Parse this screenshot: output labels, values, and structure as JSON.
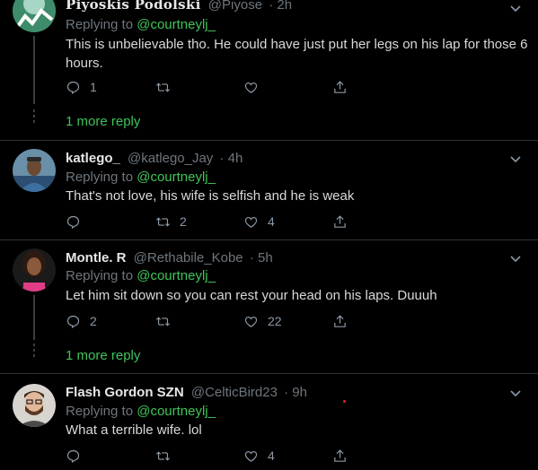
{
  "replies": [
    {
      "name": "Piyoskis Podolski",
      "handle": "@Piyose",
      "time": "· 2h",
      "replying_label": "Replying to",
      "replying_to": "@courtneylj_",
      "text": "This is unbelievable tho. He could have just put her legs on his lap for those 6 hours.",
      "reply_count": "1",
      "retweet_count": "",
      "like_count": "",
      "more_reply": "1 more reply"
    },
    {
      "name": "katlego_",
      "handle": "@katlego_Jay",
      "time": "· 4h",
      "replying_label": "Replying to",
      "replying_to": "@courtneylj_",
      "text": "That's not love, his wife is selfish and he is weak",
      "reply_count": "",
      "retweet_count": "2",
      "like_count": "4"
    },
    {
      "name": "Montle. R",
      "handle": "@Rethabile_Kobe",
      "time": "· 5h",
      "replying_label": "Replying to",
      "replying_to": "@courtneylj_",
      "text": "Let him sit down so you can rest your head on his laps. Duuuh",
      "reply_count": "2",
      "retweet_count": "",
      "like_count": "22",
      "more_reply": "1 more reply"
    },
    {
      "name": "Flash Gordon SZN",
      "handle": "@CelticBird23",
      "time": "· 9h",
      "replying_label": "Replying to",
      "replying_to": "@courtneylj_",
      "text": "What a terrible wife. lol",
      "reply_count": "",
      "retweet_count": "",
      "like_count": "4"
    }
  ],
  "colors": {
    "background": "#000000",
    "accent": "#3fc45a",
    "muted": "#6e767d",
    "divider": "#2f3336"
  }
}
